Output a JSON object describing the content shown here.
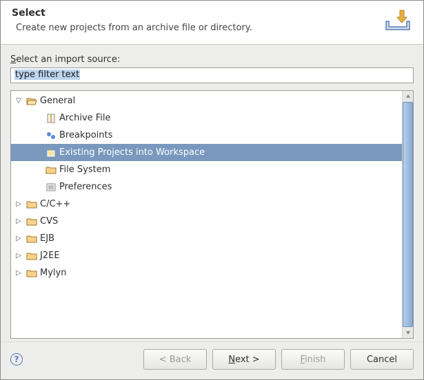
{
  "banner": {
    "title": "Select",
    "description": "Create new projects from an archive file or directory."
  },
  "label_prefix": "S",
  "label_rest": "elect an import source:",
  "filter": {
    "value": "type filter text"
  },
  "tree": [
    {
      "id": "general",
      "label": "General",
      "icon": "folder-open",
      "expanded": true,
      "level": 0,
      "children": [
        {
          "id": "archive-file",
          "label": "Archive File",
          "icon": "archive",
          "level": 1
        },
        {
          "id": "breakpoints",
          "label": "Breakpoints",
          "icon": "breakpoints",
          "level": 1
        },
        {
          "id": "existing-projects",
          "label": "Existing Projects into Workspace",
          "icon": "wizard",
          "level": 1,
          "selected": true
        },
        {
          "id": "file-system",
          "label": "File System",
          "icon": "folder",
          "level": 1
        },
        {
          "id": "preferences",
          "label": "Preferences",
          "icon": "prefs",
          "level": 1
        }
      ]
    },
    {
      "id": "c-cpp",
      "label": "C/C++",
      "icon": "folder",
      "expanded": false,
      "level": 0
    },
    {
      "id": "cvs",
      "label": "CVS",
      "icon": "folder",
      "expanded": false,
      "level": 0
    },
    {
      "id": "ejb",
      "label": "EJB",
      "icon": "folder",
      "expanded": false,
      "level": 0
    },
    {
      "id": "j2ee",
      "label": "J2EE",
      "icon": "folder",
      "expanded": false,
      "level": 0
    },
    {
      "id": "mylyn",
      "label": "Mylyn",
      "icon": "folder",
      "expanded": false,
      "level": 0
    }
  ],
  "buttons": {
    "back": "< Back",
    "next_prefix": "N",
    "next_rest": "ext >",
    "finish_prefix": "F",
    "finish_rest": "inish",
    "cancel": "Cancel"
  }
}
